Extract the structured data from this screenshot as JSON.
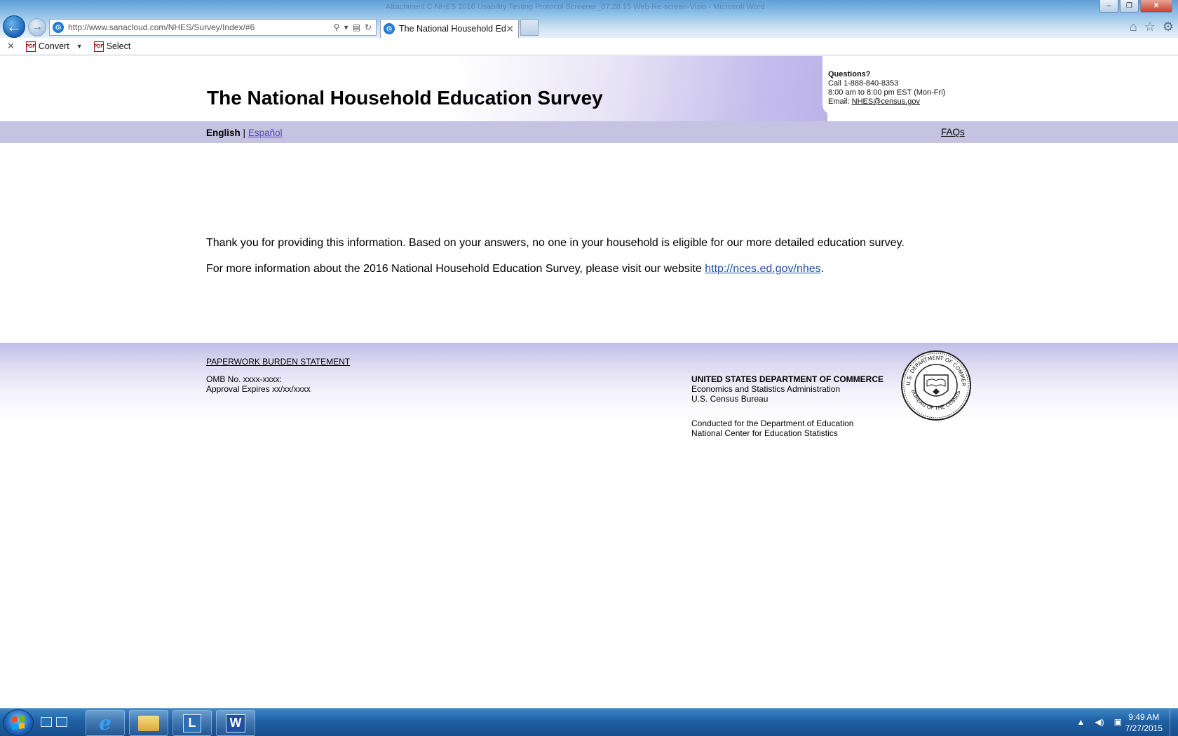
{
  "window": {
    "title": "Attachment C NHES 2016 Usability Testing Protocol Screener_07.28.15 Web-Re-screen-Vizio - Microsoft Word",
    "controls": {
      "minimize": "–",
      "restore": "❐",
      "close": "✕"
    }
  },
  "browser": {
    "url": "http://www.sanacloud.com/NHES/Survey/Index/#6",
    "tab_title": "The National Household Ed...",
    "tab_close": "✕",
    "command_bar": {
      "convert_label": "Convert",
      "select_label": "Select"
    },
    "icons": [
      "back-arrow-icon",
      "forward-arrow-icon",
      "ie-page-icon",
      "search-icon",
      "compat-view-icon",
      "refresh-icon",
      "home-icon",
      "favorites-star-icon",
      "tools-gear-icon"
    ]
  },
  "page": {
    "site_title": "The National Household Education Survey",
    "contact": {
      "heading": "Questions?",
      "phone": "Call 1-888-840-8353",
      "hours": "8:00 am to 8:00 pm EST (Mon-Fri)",
      "email_label": "Email:",
      "email": "NHES@census.gov"
    },
    "language": {
      "english": "English",
      "separator": "|",
      "spanish": "Español"
    },
    "faqs": "FAQs",
    "message": {
      "line1": "Thank you for providing this information. Based on your answers, no one in your household is eligible for our more detailed education survey.",
      "line2_prefix": "For more information about the 2016 National Household Education Survey, please visit our website",
      "link": "http://nces.ed.gov/nhes",
      "line2_suffix": "."
    },
    "footer": {
      "paperwork": "PAPERWORK BURDEN STATEMENT",
      "omb": "OMB No. xxxx-xxxx:",
      "approval": "Approval Expires xx/xx/xxxx",
      "dept": "UNITED STATES DEPARTMENT OF COMMERCE",
      "esa": "Economics and Statistics Administration",
      "bureau": "U.S. Census Bureau",
      "conducted_1": "Conducted for the Department of Education",
      "conducted_2": "National Center for Education Statistics",
      "seal_top_text": "U.S. DEPARTMENT OF COMMERCE",
      "seal_bottom_text": "BUREAU OF THE CENSUS"
    },
    "colors": {
      "lang_bar": "#c6c2e2",
      "link": "#1f4fa8",
      "spanish_link": "#5a43b8"
    }
  },
  "taskbar": {
    "apps": [
      "Internet Explorer",
      "Windows Explorer",
      "Lync",
      "Microsoft Word"
    ],
    "time": "9:49 AM",
    "date": "7/27/2015"
  }
}
